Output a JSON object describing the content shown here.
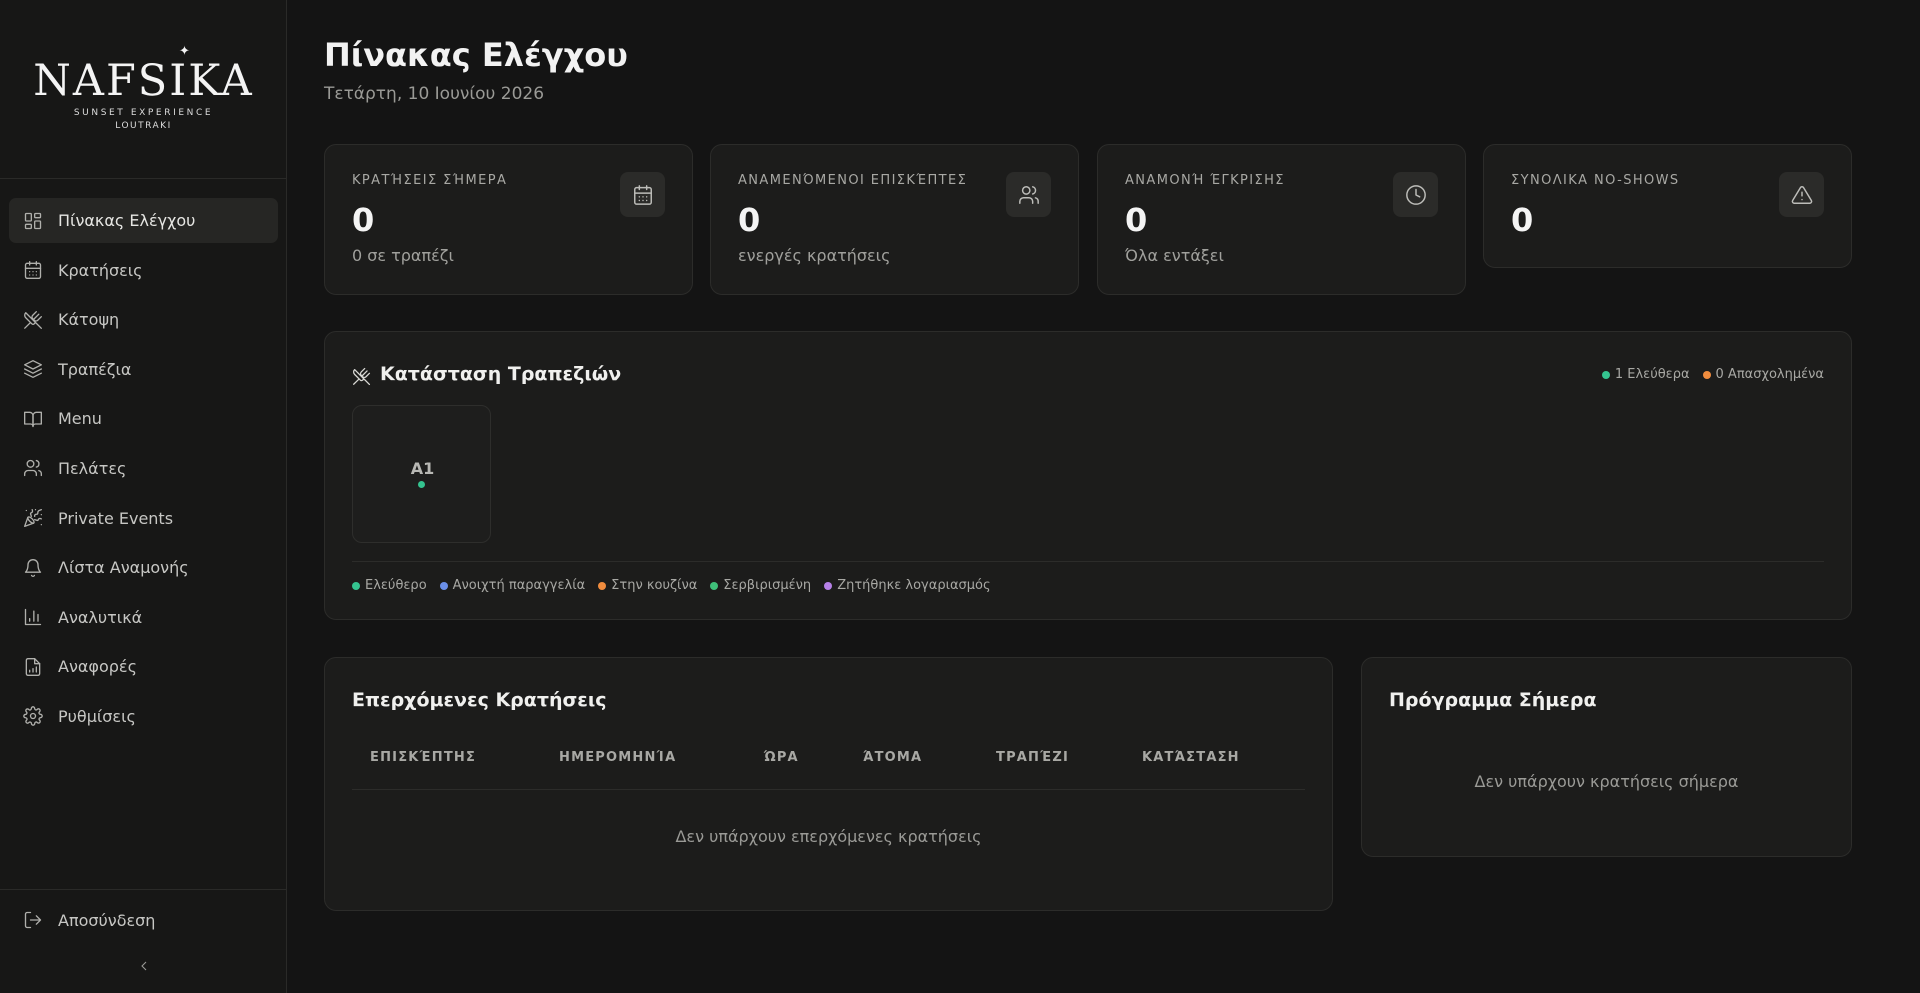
{
  "logo": {
    "name": "NAFSIKA",
    "line1": "SUNSET EXPERIENCE",
    "line2": "LOUTRAKI"
  },
  "sidebar": {
    "items": [
      {
        "label": "Πίνακας Ελέγχου",
        "icon": "dashboard-icon",
        "active": true
      },
      {
        "label": "Κρατήσεις",
        "icon": "calendar-icon"
      },
      {
        "label": "Κάτοψη",
        "icon": "utensils-icon"
      },
      {
        "label": "Τραπέζια",
        "icon": "layers-icon"
      },
      {
        "label": "Menu",
        "icon": "book-icon"
      },
      {
        "label": "Πελάτες",
        "icon": "users-icon"
      },
      {
        "label": "Private Events",
        "icon": "party-icon"
      },
      {
        "label": "Λίστα Αναμονής",
        "icon": "bell-icon"
      },
      {
        "label": "Αναλυτικά",
        "icon": "bar-chart-icon"
      },
      {
        "label": "Αναφορές",
        "icon": "report-icon"
      },
      {
        "label": "Ρυθμίσεις",
        "icon": "settings-icon"
      }
    ],
    "logout": "Αποσύνδεση",
    "collapse_icon": "chevron-left-icon"
  },
  "header": {
    "title": "Πίνακας Ελέγχου",
    "date": "Τετάρτη, 10 Ιουνίου 2026"
  },
  "stats": [
    {
      "label": "ΚΡΑΤΉΣΕΙΣ ΣΉΜΕΡΑ",
      "value": "0",
      "sub": "0 σε τραπέζι",
      "icon": "calendar-icon"
    },
    {
      "label": "ΑΝΑΜΕΝΌΜΕΝΟΙ ΕΠΙΣΚΈΠΤΕΣ",
      "value": "0",
      "sub": "ενεργές κρατήσεις",
      "icon": "users-icon"
    },
    {
      "label": "ΑΝΑΜΟΝΉ ΈΓΚΡΙΣΗΣ",
      "value": "0",
      "sub": "Όλα εντάξει",
      "icon": "clock-icon"
    },
    {
      "label": "ΣΥΝΟΛΙΚΑ NO-SHOWS",
      "value": "0",
      "sub": "",
      "icon": "alert-triangle-icon"
    }
  ],
  "tables_status": {
    "title": "Κατάσταση Τραπεζιών",
    "free_count": "1 Ελεύθερα",
    "busy_count": "0 Απασχολημένα",
    "tables": [
      {
        "name": "A1",
        "status_color": "#34c38f"
      }
    ],
    "legend": [
      {
        "label": "Ελεύθερο",
        "color": "#34c38f"
      },
      {
        "label": "Ανοιχτή παραγγελία",
        "color": "#6b8fe8"
      },
      {
        "label": "Στην κουζίνα",
        "color": "#f08c3e"
      },
      {
        "label": "Σερβιρισμένη",
        "color": "#3fbf7a"
      },
      {
        "label": "Ζητήθηκε λογαριασμός",
        "color": "#b681e8"
      }
    ],
    "colors": {
      "free": "#34c38f",
      "busy": "#f08c3e"
    }
  },
  "upcoming": {
    "title": "Επερχόμενες Κρατήσεις",
    "columns": [
      "ΕΠΙΣΚΈΠΤΗΣ",
      "ΗΜΕΡΟΜΗΝΊΑ",
      "ΏΡΑ",
      "ΆΤΟΜΑ",
      "ΤΡΑΠΈΖΙ",
      "ΚΑΤΆΣΤΑΣΗ"
    ],
    "empty": "Δεν υπάρχουν επερχόμενες κρατήσεις"
  },
  "schedule": {
    "title": "Πρόγραμμα Σήμερα",
    "empty": "Δεν υπάρχουν κρατήσεις σήμερα"
  }
}
